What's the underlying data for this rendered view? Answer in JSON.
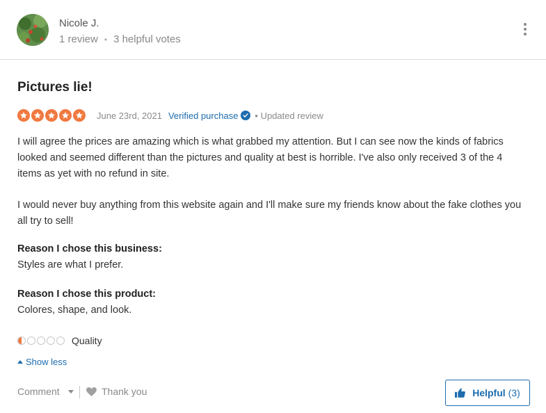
{
  "reviewer": {
    "name": "Nicole J.",
    "reviews": "1 review",
    "separator": "•",
    "helpful_votes": "3 helpful votes",
    "more_icon": "kebab-menu-icon"
  },
  "review": {
    "title": "Pictures lie!",
    "rating": 5,
    "rating_max": 5,
    "date": "June 23rd, 2021",
    "verified_label": "Verified purchase",
    "updated_label": "• Updated review",
    "paragraphs": [
      "I will agree the prices are amazing which is what grabbed my attention. But I can see now the kinds of fabrics looked and seemed different than the pictures and quality at best is horrible. I've also only received 3 of the 4 items as yet with no refund in site.",
      "I would never buy anything from this website again and I'll make sure my friends know about the fake clothes you all try to sell!"
    ],
    "reasons": [
      {
        "label": "Reason I chose this business:",
        "value": "Styles are what I prefer."
      },
      {
        "label": "Reason I chose this product:",
        "value": "Colores, shape, and look."
      }
    ],
    "quality": {
      "label": "Quality",
      "rating": 0.5,
      "max": 5
    }
  },
  "actions": {
    "show_less": "Show less",
    "comment": "Comment",
    "thank_you": "Thank you",
    "helpful_label": "Helpful",
    "helpful_count": "(3)"
  },
  "colors": {
    "star": "#f0793f",
    "link": "#1c6cae",
    "muted": "#8a8a8a",
    "divider": "#dcdcdc"
  }
}
